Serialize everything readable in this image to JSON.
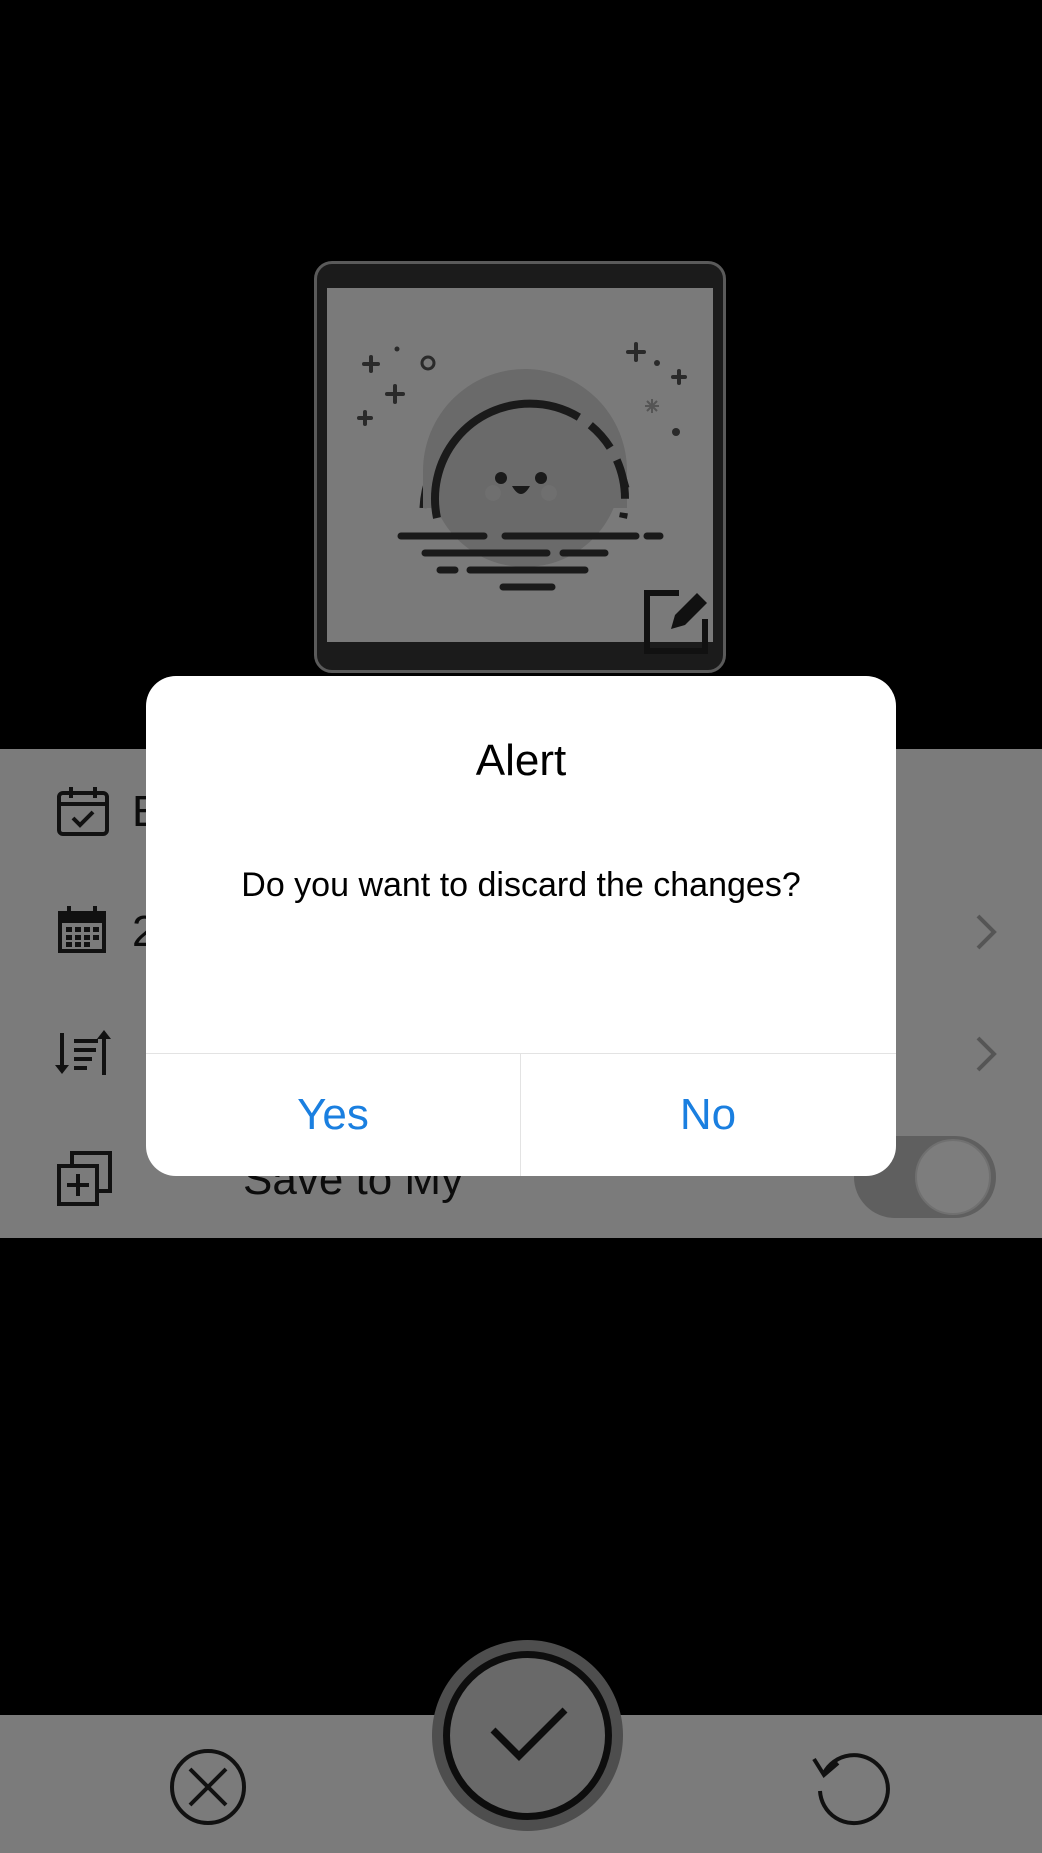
{
  "dialog": {
    "title": "Alert",
    "message": "Do you want to discard the changes?",
    "yes_label": "Yes",
    "no_label": "No"
  },
  "settings": {
    "rows": [
      {
        "icon": "calendar-check-icon",
        "label": "E"
      },
      {
        "icon": "calendar-grid-icon",
        "label": "2"
      },
      {
        "icon": "sort-icon",
        "label": ""
      },
      {
        "icon": "copy-add-icon",
        "label": "Save to My"
      }
    ],
    "save_toggle_on": false
  },
  "bottom_bar": {
    "cancel_icon": "close-circle-icon",
    "confirm_icon": "checkmark-icon",
    "reset_icon": "rotate-left-icon"
  },
  "photo": {
    "image_icon": "sunset-moon-illustration",
    "edit_icon": "edit-icon"
  },
  "colors": {
    "accent": "#1a7fe0",
    "overlay_panel": "#7b7b7b",
    "background": "#000000"
  }
}
